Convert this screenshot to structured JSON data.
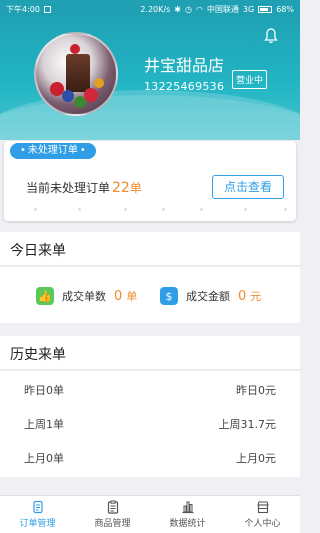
{
  "status_bar": {
    "time": "下午4:00",
    "speed": "2.20K/s",
    "carrier": "中国联通",
    "network": "3G",
    "battery": "68%",
    "battery_level": 0.68
  },
  "shop": {
    "name": "井宝甜品店",
    "phone": "13225469536",
    "status": "营业中"
  },
  "pending": {
    "title": "未处理订单",
    "prefix": "当前未处理订单",
    "count": "22",
    "unit": "单",
    "button": "点击查看"
  },
  "today": {
    "title": "今日来单",
    "orders_label": "成交单数",
    "orders_value": "0",
    "orders_unit": "单",
    "amount_label": "成交金额",
    "amount_value": "0",
    "amount_unit": "元"
  },
  "history": {
    "title": "历史来单",
    "rows": [
      {
        "left": "昨日0单",
        "right": "昨日0元"
      },
      {
        "left": "上周1单",
        "right": "上周31.7元"
      },
      {
        "left": "上月0单",
        "right": "上月0元"
      }
    ]
  },
  "tabs": [
    {
      "label": "订单管理",
      "icon": "orders-icon",
      "active": true
    },
    {
      "label": "商品管理",
      "icon": "clipboard-icon",
      "active": false
    },
    {
      "label": "数据统计",
      "icon": "bar-chart-icon",
      "active": false
    },
    {
      "label": "个人中心",
      "icon": "store-icon",
      "active": false
    }
  ],
  "colors": {
    "primary": "#2f9ee6",
    "header": "#22b5c4",
    "accent": "#f08a2a"
  }
}
